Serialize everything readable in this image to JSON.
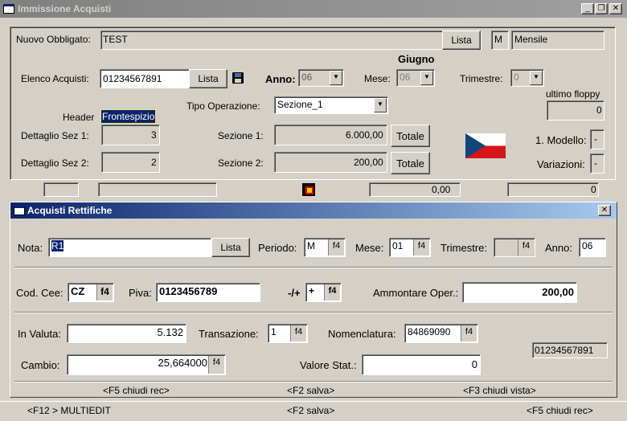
{
  "window": {
    "title": "Immissione  Acquisti",
    "minimize": "_",
    "restore": "❐",
    "close": "✕"
  },
  "top": {
    "nuovo_obbligato_label": "Nuovo Obbligato:",
    "nuovo_obbligato_value": "TEST",
    "lista_label": "Lista",
    "m_label": "M",
    "mensile": "Mensile",
    "month_header": "Giugno",
    "elenco_label": "Elenco Acquisti:",
    "elenco_value": "01234567891",
    "elenco_lista": "Lista",
    "anno_label": "Anno:",
    "anno_value": "06",
    "mese_label": "Mese:",
    "mese_value": "06",
    "trimestre_label": "Trimestre:",
    "trimestre_value": "0",
    "ultimo_floppy_label": "ultimo floppy",
    "ultimo_floppy_value": "0",
    "header_label": "Header",
    "header_value": "Frontespizio",
    "tipo_label": "Tipo Operazione:",
    "tipo_value": "Sezione_1",
    "dettaglio1_label": "Dettaglio Sez 1:",
    "dettaglio1_value": "3",
    "dettaglio2_label": "Dettaglio Sez 2:",
    "dettaglio2_value": "2",
    "sezione1_label": "Sezione 1:",
    "sezione1_value": "6.000,00",
    "sezione2_label": "Sezione 2:",
    "sezione2_value": "200,00",
    "totale_label": "Totale",
    "modello_label": "1. Modello:",
    "modello_value": "-",
    "variazioni_label": "Variazioni:",
    "variazioni_value": "-"
  },
  "status_strip": {
    "amount": "0,00",
    "count": "0"
  },
  "dialog": {
    "title": "Acquisti Rettifiche",
    "close": "✕",
    "nota_label": "Nota:",
    "nota_value": "R1",
    "lista": "Lista",
    "periodo_label": "Periodo:",
    "periodo_value": "M",
    "mese_label": "Mese:",
    "mese_value": "01",
    "trimestre_label": "Trimestre:",
    "anno_label": "Anno:",
    "anno_value": "06",
    "f4": "f4",
    "codcee_label": "Cod. Cee:",
    "codcee_value": "CZ",
    "piva_label": "Piva:",
    "piva_value": "0123456789",
    "sign_label": "-/+",
    "sign_value": "+",
    "ammontare_label": "Ammontare Oper.:",
    "ammontare_value": "200,00",
    "invaluta_label": "In Valuta:",
    "invaluta_value": "5.132",
    "transazione_label": "Transazione:",
    "transazione_value": "1",
    "nomenclatura_label": "Nomenclatura:",
    "nomenclatura_value": "84869090",
    "ref_value": "01234567891",
    "cambio_label": "Cambio:",
    "cambio_value": "25,664000",
    "valorestat_label": "Valore Stat.:",
    "valorestat_value": "0",
    "f5": "<F5 chiudi rec>",
    "f2": "<F2 salva>",
    "f3": "<F3 chiudi vista>"
  },
  "bottom": {
    "f12": "<F12 > MULTIEDIT",
    "f2": "<F2 salva>",
    "f5": "<F5 chiudi rec>"
  },
  "colors": {
    "titlebar_inactive": "#808080",
    "titlebar_active": "#0a246a",
    "flag_blue": "#11457e",
    "flag_red": "#d7141a"
  }
}
